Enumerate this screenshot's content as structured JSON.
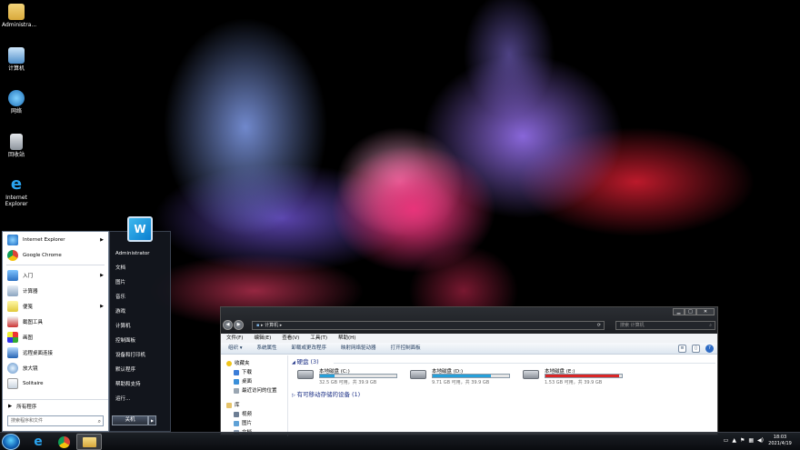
{
  "desktop": {
    "icons": [
      {
        "label": "Administra...",
        "icon": "folder-icon"
      },
      {
        "label": "计算机",
        "icon": "computer-icon"
      },
      {
        "label": "网络",
        "icon": "network-icon"
      },
      {
        "label": "回收站",
        "icon": "recycle-bin-icon"
      },
      {
        "label": "Internet Explorer",
        "icon": "ie-icon"
      }
    ]
  },
  "start_menu": {
    "pinned": [
      {
        "label": "Internet Explorer",
        "icon": "ie-icon",
        "has_arrow": true
      },
      {
        "label": "Google Chrome",
        "icon": "chrome-icon",
        "has_arrow": false
      }
    ],
    "recent": [
      {
        "label": "入门",
        "icon": "getting-started-icon",
        "has_arrow": true
      },
      {
        "label": "计算器",
        "icon": "calculator-icon",
        "has_arrow": false
      },
      {
        "label": "便笺",
        "icon": "sticky-notes-icon",
        "has_arrow": true
      },
      {
        "label": "截图工具",
        "icon": "snipping-tool-icon",
        "has_arrow": false
      },
      {
        "label": "画图",
        "icon": "paint-icon",
        "has_arrow": false
      },
      {
        "label": "远程桌面连接",
        "icon": "remote-desktop-icon",
        "has_arrow": false
      },
      {
        "label": "放大镜",
        "icon": "magnifier-icon",
        "has_arrow": false
      },
      {
        "label": "Solitaire",
        "icon": "solitaire-icon",
        "has_arrow": false
      }
    ],
    "all_programs": "所有程序",
    "search_placeholder": "搜索程序和文件",
    "right_items": [
      "Administrator",
      "文档",
      "图片",
      "音乐",
      "游戏",
      "计算机",
      "控制面板",
      "设备和打印机",
      "默认程序",
      "帮助和支持",
      "运行..."
    ],
    "shutdown_label": "关机"
  },
  "explorer": {
    "address": "计算机",
    "search_placeholder": "搜索 计算机",
    "menu": [
      "文件(F)",
      "编辑(E)",
      "查看(V)",
      "工具(T)",
      "帮助(H)"
    ],
    "toolbar": [
      "组织 ▾",
      "系统属性",
      "卸载或更改程序",
      "映射网络驱动器",
      "打开控制面板"
    ],
    "nav_pane": [
      {
        "label": "收藏夹",
        "head": true,
        "icon": "star-icon"
      },
      {
        "label": "下载",
        "head": false,
        "icon": "download-folder-icon"
      },
      {
        "label": "桌面",
        "head": false,
        "icon": "desktop-folder-icon"
      },
      {
        "label": "最近访问的位置",
        "head": false,
        "icon": "recent-places-icon"
      },
      {
        "label": "库",
        "head": true,
        "icon": "library-icon"
      },
      {
        "label": "视频",
        "head": false,
        "icon": "videos-icon"
      },
      {
        "label": "图片",
        "head": false,
        "icon": "pictures-icon"
      },
      {
        "label": "文档",
        "head": false,
        "icon": "documents-icon"
      }
    ],
    "hdd_group": "硬盘 (3)",
    "drives": [
      {
        "name": "本地磁盘 (C:)",
        "free": "32.5 GB 可用，共 39.9 GB",
        "used_fraction": 0.19,
        "color": "#26a0da"
      },
      {
        "name": "本地磁盘 (D:)",
        "free": "9.71 GB 可用，共 39.9 GB",
        "used_fraction": 0.76,
        "color": "#26a0da"
      },
      {
        "name": "本地磁盘 (E:)",
        "free": "1.53 GB 可用，共 39.9 GB",
        "used_fraction": 0.96,
        "color": "#da2626"
      }
    ],
    "removable_group": "有可移动存储的设备 (1)"
  },
  "taskbar": {
    "apps": [
      {
        "name": "ie",
        "icon": "ie-icon"
      },
      {
        "name": "chrome",
        "icon": "chrome-icon"
      },
      {
        "name": "explorer",
        "icon": "folder-icon"
      }
    ],
    "time": "18:03",
    "date": "2021/4/19"
  }
}
